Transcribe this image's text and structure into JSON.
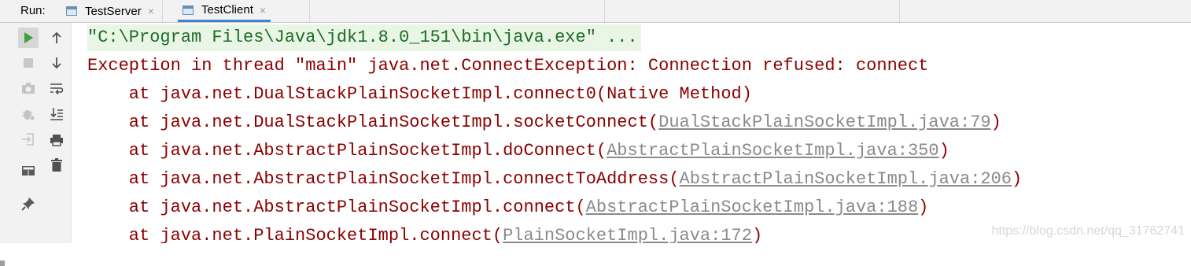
{
  "run_bar": {
    "label": "Run:",
    "tabs": [
      {
        "label": "TestServer",
        "close": "×",
        "icon": "app-window-icon"
      },
      {
        "label": "TestClient",
        "close": "×",
        "icon": "app-window-icon"
      }
    ],
    "active_tab": "TestClient",
    "accent_color": "#4083c9"
  },
  "toolbar": {
    "primary": [
      "rerun-icon",
      "stop-icon",
      "camera-icon",
      "bug-settings-icon",
      "exit-icon",
      "layout-icon",
      "pin-icon"
    ],
    "secondary": [
      "arrow-up-icon",
      "arrow-down-icon",
      "soft-wrap-icon",
      "scroll-to-end-icon",
      "print-icon",
      "trash-icon"
    ]
  },
  "console": {
    "command": "\"C:\\Program Files\\Java\\jdk1.8.0_151\\bin\\java.exe\" ...",
    "exception": "Exception in thread \"main\" java.net.ConnectException: Connection refused: connect",
    "frames": [
      {
        "prefix": "    at java.net.DualStackPlainSocketImpl.connect0(Native Method)",
        "link": "",
        "suffix": ""
      },
      {
        "prefix": "    at java.net.DualStackPlainSocketImpl.socketConnect(",
        "link": "DualStackPlainSocketImpl.java:79",
        "suffix": ")"
      },
      {
        "prefix": "    at java.net.AbstractPlainSocketImpl.doConnect(",
        "link": "AbstractPlainSocketImpl.java:350",
        "suffix": ")"
      },
      {
        "prefix": "    at java.net.AbstractPlainSocketImpl.connectToAddress(",
        "link": "AbstractPlainSocketImpl.java:206",
        "suffix": ")"
      },
      {
        "prefix": "    at java.net.AbstractPlainSocketImpl.connect(",
        "link": "AbstractPlainSocketImpl.java:188",
        "suffix": ")"
      },
      {
        "prefix": "    at java.net.PlainSocketImpl.connect(",
        "link": "PlainSocketImpl.java:172",
        "suffix": ")"
      }
    ],
    "colors": {
      "error": "#8b0000",
      "command": "#1f6b27",
      "command_bg": "#e9f6e6",
      "link": "#8a8a8a"
    }
  },
  "watermark": "https://blog.csdn.net/qq_31762741"
}
